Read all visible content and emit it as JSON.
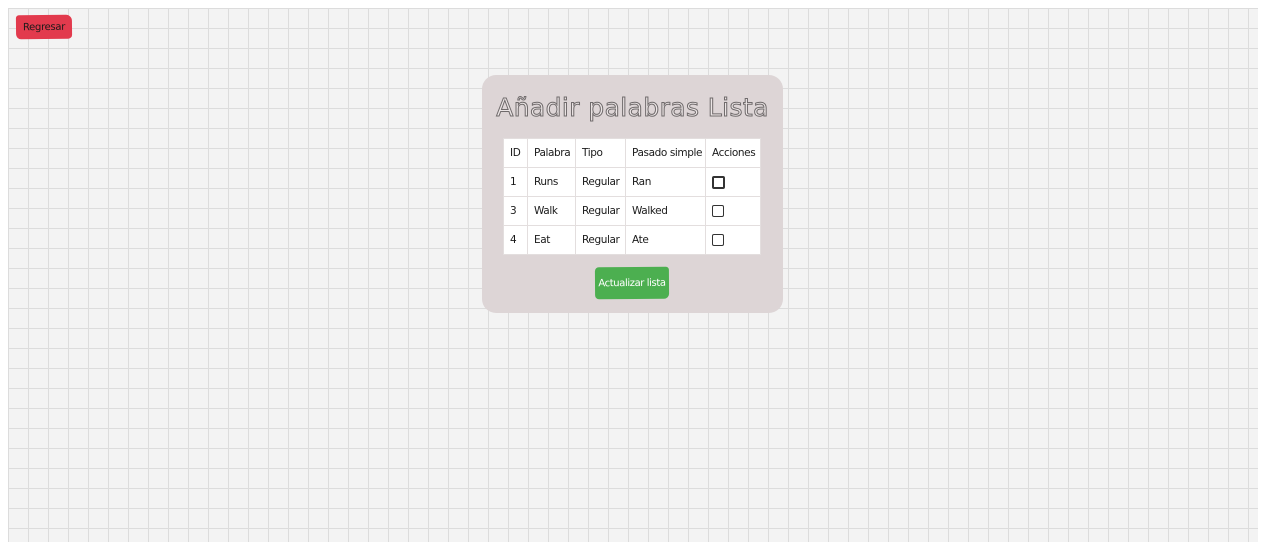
{
  "nav": {
    "back_label": "Regresar"
  },
  "card": {
    "title": "Añadir palabras Lista",
    "update_label": "Actualizar lista"
  },
  "table": {
    "headers": {
      "id": "ID",
      "word": "Palabra",
      "type": "Tipo",
      "past": "Pasado simple",
      "actions": "Acciones"
    },
    "rows": [
      {
        "id": "1",
        "word": "Runs",
        "type": "Regular",
        "past": "Ran",
        "checked": false
      },
      {
        "id": "3",
        "word": "Walk",
        "type": "Regular",
        "past": "Walked",
        "checked": false
      },
      {
        "id": "4",
        "word": "Eat",
        "type": "Regular",
        "past": "Ate",
        "checked": false
      }
    ]
  },
  "colors": {
    "back_button": "#e23a4d",
    "update_button": "#4caf50",
    "card_background": "#ddd5d6",
    "grid_line": "#dcdcdc"
  },
  "icons": {
    "row_action": "checkbox"
  }
}
